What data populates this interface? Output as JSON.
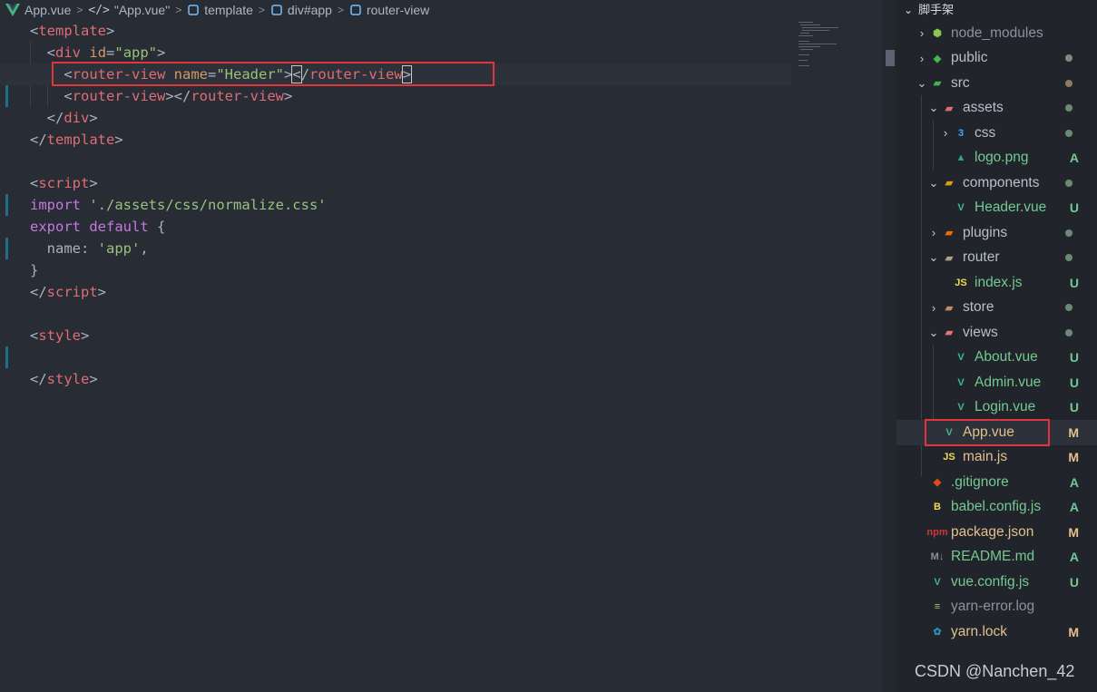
{
  "breadcrumb": {
    "file": "App.vue",
    "symbol": "\"App.vue\"",
    "symbol_icon": "</>",
    "path": [
      "template",
      "div#app",
      "router-view"
    ],
    "separator": ">"
  },
  "editor": {
    "lines": [
      [
        {
          "t": "punc",
          "v": "<"
        },
        {
          "t": "tag",
          "v": "template"
        },
        {
          "t": "punc",
          "v": ">"
        }
      ],
      [
        {
          "t": "plain",
          "v": "  "
        },
        {
          "t": "punc",
          "v": "<"
        },
        {
          "t": "tag",
          "v": "div"
        },
        {
          "t": "plain",
          "v": " "
        },
        {
          "t": "attr",
          "v": "id"
        },
        {
          "t": "punc",
          "v": "="
        },
        {
          "t": "str",
          "v": "\"app\""
        },
        {
          "t": "punc",
          "v": ">"
        }
      ],
      [
        {
          "t": "plain",
          "v": "    "
        },
        {
          "t": "punc",
          "v": "<"
        },
        {
          "t": "tag",
          "v": "router-view"
        },
        {
          "t": "plain",
          "v": " "
        },
        {
          "t": "attr",
          "v": "name"
        },
        {
          "t": "punc",
          "v": "="
        },
        {
          "t": "str",
          "v": "\"Header\""
        },
        {
          "t": "punc",
          "v": ">"
        },
        {
          "t": "cursor",
          "v": "<"
        },
        {
          "t": "punc",
          "v": "/"
        },
        {
          "t": "tag",
          "v": "router-view"
        },
        {
          "t": "cursor",
          "v": ">"
        }
      ],
      [
        {
          "t": "plain",
          "v": "    "
        },
        {
          "t": "punc",
          "v": "<"
        },
        {
          "t": "tag",
          "v": "router-view"
        },
        {
          "t": "punc",
          "v": "></"
        },
        {
          "t": "tag",
          "v": "router-view"
        },
        {
          "t": "punc",
          "v": ">"
        }
      ],
      [
        {
          "t": "plain",
          "v": "  "
        },
        {
          "t": "punc",
          "v": "</"
        },
        {
          "t": "tag",
          "v": "div"
        },
        {
          "t": "punc",
          "v": ">"
        }
      ],
      [
        {
          "t": "punc",
          "v": "</"
        },
        {
          "t": "tag",
          "v": "template"
        },
        {
          "t": "punc",
          "v": ">"
        }
      ],
      [],
      [
        {
          "t": "punc",
          "v": "<"
        },
        {
          "t": "tag",
          "v": "script"
        },
        {
          "t": "punc",
          "v": ">"
        }
      ],
      [
        {
          "t": "kw",
          "v": "import"
        },
        {
          "t": "plain",
          "v": " "
        },
        {
          "t": "str",
          "v": "'./assets/css/normalize.css'"
        }
      ],
      [
        {
          "t": "kw",
          "v": "export"
        },
        {
          "t": "plain",
          "v": " "
        },
        {
          "t": "kw",
          "v": "default"
        },
        {
          "t": "plain",
          "v": " {"
        }
      ],
      [
        {
          "t": "plain",
          "v": "  name: "
        },
        {
          "t": "str",
          "v": "'app'"
        },
        {
          "t": "plain",
          "v": ","
        }
      ],
      [
        {
          "t": "plain",
          "v": "}"
        }
      ],
      [
        {
          "t": "punc",
          "v": "</"
        },
        {
          "t": "tag",
          "v": "script"
        },
        {
          "t": "punc",
          "v": ">"
        }
      ],
      [],
      [
        {
          "t": "punc",
          "v": "<"
        },
        {
          "t": "tag",
          "v": "style"
        },
        {
          "t": "punc",
          "v": ">"
        }
      ],
      [],
      [
        {
          "t": "punc",
          "v": "</"
        },
        {
          "t": "tag",
          "v": "style"
        },
        {
          "t": "punc",
          "v": ">"
        }
      ]
    ]
  },
  "explorer": {
    "title": "脚手架",
    "items": [
      {
        "label": "node_modules",
        "depth": 0,
        "chevron": "›",
        "icon": "node-folder-icon",
        "status": "",
        "dot": "",
        "muted": true
      },
      {
        "label": "public",
        "depth": 0,
        "chevron": "›",
        "icon": "public-folder-icon",
        "status": "",
        "dot": "#7f8b7f"
      },
      {
        "label": "src",
        "depth": 0,
        "chevron": "⌄",
        "icon": "src-folder-icon",
        "status": "",
        "dot": "#8e7a63"
      },
      {
        "label": "assets",
        "depth": 1,
        "chevron": "⌄",
        "icon": "assets-folder-icon",
        "status": "",
        "dot": "#6b8a74"
      },
      {
        "label": "css",
        "depth": 2,
        "chevron": "›",
        "icon": "css-icon",
        "status": "",
        "dot": "#6b8a74"
      },
      {
        "label": "logo.png",
        "depth": 2,
        "chevron": "",
        "icon": "image-icon",
        "status": "A",
        "dot": ""
      },
      {
        "label": "components",
        "depth": 1,
        "chevron": "⌄",
        "icon": "components-folder-icon",
        "status": "",
        "dot": "#6b8a74"
      },
      {
        "label": "Header.vue",
        "depth": 2,
        "chevron": "",
        "icon": "vue-file-icon",
        "status": "U",
        "dot": ""
      },
      {
        "label": "plugins",
        "depth": 1,
        "chevron": "›",
        "icon": "plugins-folder-icon",
        "status": "",
        "dot": "#6b8a74"
      },
      {
        "label": "router",
        "depth": 1,
        "chevron": "⌄",
        "icon": "router-folder-icon",
        "status": "",
        "dot": "#6b8a74"
      },
      {
        "label": "index.js",
        "depth": 2,
        "chevron": "",
        "icon": "js-icon",
        "status": "U",
        "dot": ""
      },
      {
        "label": "store",
        "depth": 1,
        "chevron": "›",
        "icon": "store-folder-icon",
        "status": "",
        "dot": "#6b8a74"
      },
      {
        "label": "views",
        "depth": 1,
        "chevron": "⌄",
        "icon": "views-folder-icon",
        "status": "",
        "dot": "#6b8a74"
      },
      {
        "label": "About.vue",
        "depth": 2,
        "chevron": "",
        "icon": "vue-file-icon",
        "status": "U",
        "dot": ""
      },
      {
        "label": "Admin.vue",
        "depth": 2,
        "chevron": "",
        "icon": "vue-file-icon",
        "status": "U",
        "dot": ""
      },
      {
        "label": "Login.vue",
        "depth": 2,
        "chevron": "",
        "icon": "vue-file-icon",
        "status": "U",
        "dot": ""
      },
      {
        "label": "App.vue",
        "depth": 1,
        "chevron": "",
        "icon": "vue-file-icon",
        "status": "M",
        "dot": "",
        "selected": true
      },
      {
        "label": "main.js",
        "depth": 1,
        "chevron": "",
        "icon": "js-icon",
        "status": "M",
        "dot": ""
      },
      {
        "label": ".gitignore",
        "depth": 0,
        "chevron": "",
        "icon": "git-icon",
        "status": "A",
        "dot": ""
      },
      {
        "label": "babel.config.js",
        "depth": 0,
        "chevron": "",
        "icon": "babel-icon",
        "status": "A",
        "dot": ""
      },
      {
        "label": "package.json",
        "depth": 0,
        "chevron": "",
        "icon": "npm-icon",
        "status": "M",
        "dot": ""
      },
      {
        "label": "README.md",
        "depth": 0,
        "chevron": "",
        "icon": "markdown-icon",
        "status": "A",
        "dot": ""
      },
      {
        "label": "vue.config.js",
        "depth": 0,
        "chevron": "",
        "icon": "vue-config-icon",
        "status": "U",
        "dot": ""
      },
      {
        "label": "yarn-error.log",
        "depth": 0,
        "chevron": "",
        "icon": "log-icon",
        "status": "",
        "dot": "",
        "muted": true
      },
      {
        "label": "yarn.lock",
        "depth": 0,
        "chevron": "",
        "icon": "yarn-icon",
        "status": "M",
        "dot": ""
      }
    ]
  },
  "status_colors": {
    "A": "#73c991",
    "U": "#73c991",
    "M": "#e2c08d"
  },
  "watermark": "CSDN @Nanchen_42"
}
